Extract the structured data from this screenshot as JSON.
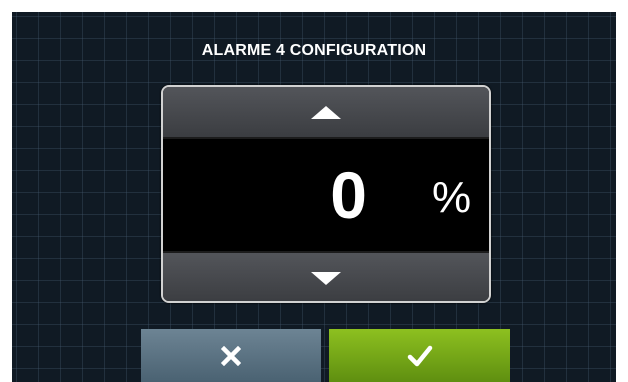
{
  "dialog": {
    "title": "ALARME 4 CONFIGURATION",
    "value": "0",
    "unit": "%"
  },
  "buttons": {
    "increment_icon": "triangle-up-icon",
    "decrement_icon": "triangle-down-icon",
    "cancel_icon": "close-icon",
    "confirm_icon": "checkmark-icon"
  },
  "colors": {
    "background": "#101a24",
    "cancel_button": "#5a7282",
    "confirm_button": "#77a818",
    "stepper_button": "#47494d",
    "text": "#ffffff"
  }
}
